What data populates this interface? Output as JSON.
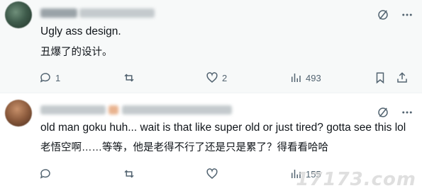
{
  "posts": [
    {
      "text_en": "Ugly ass design.",
      "text_cn": "丑爆了的设计。",
      "actions": {
        "replies": "1",
        "reposts": "",
        "likes": "2",
        "views": "493"
      }
    },
    {
      "text_en": "old man goku huh... wait is that like super old or just tired? gotta see this lol",
      "text_cn": "老悟空啊……等等，他是老得不行了还是只是累了？得看看哈哈",
      "actions": {
        "replies": "",
        "reposts": "",
        "likes": "",
        "views": "155"
      }
    }
  ],
  "watermark": {
    "text": "17173.com"
  },
  "colors": {
    "action_gray": "#536471",
    "highlight_bg": "#f7f9f9"
  }
}
